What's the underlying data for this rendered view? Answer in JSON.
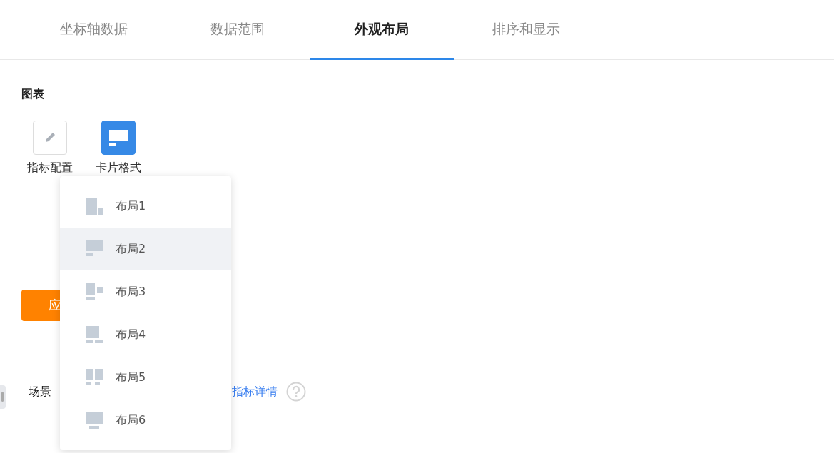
{
  "tabs": [
    {
      "label": "坐标轴数据",
      "selected": false
    },
    {
      "label": "数据范围",
      "selected": false
    },
    {
      "label": "外观布局",
      "selected": true
    },
    {
      "label": "排序和显示",
      "selected": false
    }
  ],
  "section_title": "图表",
  "chart_options": [
    {
      "label": "指标配置",
      "kind": "pencil",
      "selected": false
    },
    {
      "label": "卡片格式",
      "kind": "card",
      "selected": true
    }
  ],
  "apply_button": "应",
  "layout_menu": [
    {
      "label": "布局1",
      "kind": "tall-left",
      "selected": false
    },
    {
      "label": "布局2",
      "kind": "wide-top",
      "selected": true
    },
    {
      "label": "布局3",
      "kind": "split-bottom",
      "selected": false
    },
    {
      "label": "布局4",
      "kind": "square-two",
      "selected": false
    },
    {
      "label": "布局5",
      "kind": "two-columns",
      "selected": false
    },
    {
      "label": "布局6",
      "kind": "monitor",
      "selected": false
    }
  ],
  "footer": {
    "scene_label": "场景",
    "details_link": "指标详情"
  }
}
